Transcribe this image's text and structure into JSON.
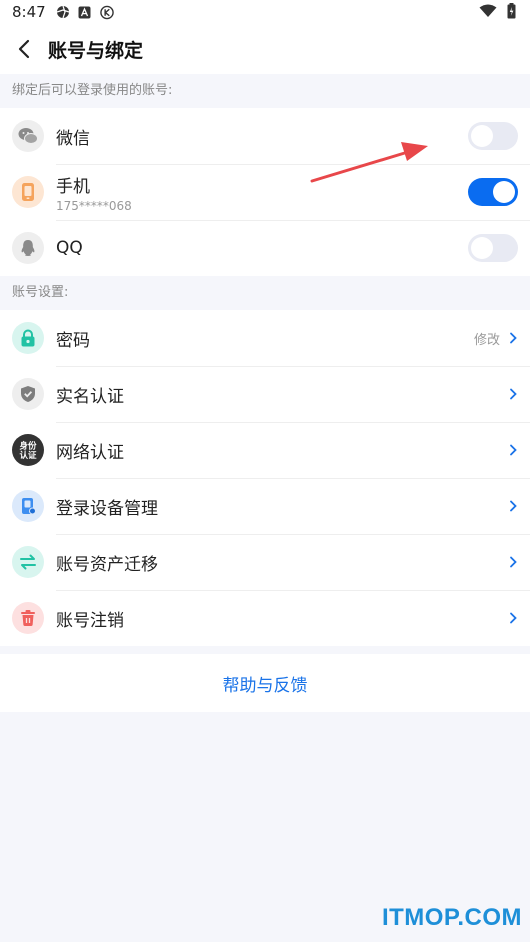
{
  "status": {
    "time": "8:47"
  },
  "header": {
    "title": "账号与绑定"
  },
  "binding": {
    "section_label": "绑定后可以登录使用的账号:",
    "items": [
      {
        "label": "微信",
        "sub": "",
        "enabled": false,
        "icon": "wechat-icon"
      },
      {
        "label": "手机",
        "sub": "175*****068",
        "enabled": true,
        "icon": "phone-icon"
      },
      {
        "label": "QQ",
        "sub": "",
        "enabled": false,
        "icon": "qq-icon"
      }
    ]
  },
  "settings": {
    "section_label": "账号设置:",
    "items": [
      {
        "label": "密码",
        "hint": "修改",
        "icon": "lock-icon"
      },
      {
        "label": "实名认证",
        "hint": "",
        "icon": "shield-icon"
      },
      {
        "label": "网络认证",
        "hint": "",
        "icon": "id-auth-icon"
      },
      {
        "label": "登录设备管理",
        "hint": "",
        "icon": "device-icon"
      },
      {
        "label": "账号资产迁移",
        "hint": "",
        "icon": "transfer-icon"
      },
      {
        "label": "账号注销",
        "hint": "",
        "icon": "trash-icon"
      }
    ],
    "id_badge_text_top": "身份",
    "id_badge_text_bottom": "认证"
  },
  "footer": {
    "help_label": "帮助与反馈"
  },
  "watermark": "ITMOP.COM",
  "colors": {
    "accent": "#0a6cf0",
    "link": "#1a73e8",
    "annotation_arrow": "#e8474a"
  }
}
